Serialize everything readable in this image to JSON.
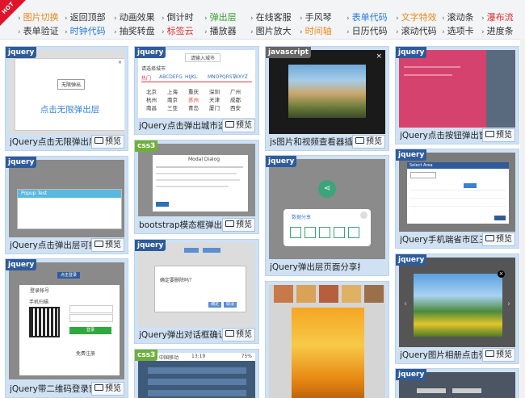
{
  "nav": {
    "hot_label": "HOT",
    "row1": [
      {
        "label": "图片切换",
        "color": "#e8891d"
      },
      {
        "label": "返回顶部",
        "color": "#333333"
      },
      {
        "label": "动画效果",
        "color": "#333333"
      },
      {
        "label": "倒计时",
        "color": "#333333"
      },
      {
        "label": "弹出层",
        "color": "#3aa02e"
      },
      {
        "label": "在线客服",
        "color": "#333333"
      },
      {
        "label": "手风琴",
        "color": "#333333"
      },
      {
        "label": "表单代码",
        "color": "#2a7bd6"
      },
      {
        "label": "文字特效",
        "color": "#e8891d"
      },
      {
        "label": "滚动条",
        "color": "#333333"
      },
      {
        "label": "瀑布流",
        "color": "#e03030"
      }
    ],
    "row2": [
      {
        "label": "表单验证",
        "color": "#333333"
      },
      {
        "label": "时钟代码",
        "color": "#2a7bd6"
      },
      {
        "label": "抽奖转盘",
        "color": "#333333"
      },
      {
        "label": "标签云",
        "color": "#e03030"
      },
      {
        "label": "播放器",
        "color": "#333333"
      },
      {
        "label": "图片放大",
        "color": "#333333"
      },
      {
        "label": "时间轴",
        "color": "#e8891d"
      },
      {
        "label": "日历代码",
        "color": "#333333"
      },
      {
        "label": "滚动代码",
        "color": "#333333"
      },
      {
        "label": "选项卡",
        "color": "#333333"
      },
      {
        "label": "进度条",
        "color": "#333333"
      }
    ]
  },
  "preview_label": "预览",
  "cards": {
    "c1": {
      "badge": "jquery",
      "title": "jQuery点击无限弹出层插件",
      "thumb_btn": "无限弹出",
      "thumb_link": "点击无限弹出层"
    },
    "c2": {
      "badge": "jquery",
      "title": "jQuery点击弹出城市选择器",
      "thumb_search": "请输入城市",
      "thumb_head": "请选择城市",
      "tabs": [
        "热门",
        "ABCDEFG",
        "HIJKL",
        "MNOPQRST",
        "WXYZ"
      ],
      "cities": [
        "北京",
        "上海",
        "重庆",
        "深圳",
        "广州",
        "杭州",
        "南京",
        "苏州",
        "天津",
        "成都",
        "南昌",
        "三亚",
        "青岛",
        "厦门",
        "西安"
      ]
    },
    "c3": {
      "badge": "javascript",
      "title": "js图片和视频查看器插件"
    },
    "c4": {
      "badge": "jquery",
      "title": "jQuery点击按钮弹出窗口动"
    },
    "c5": {
      "badge": "css3",
      "title": "bootstrap模态框弹出效果",
      "thumb_head": "Modal Dialog"
    },
    "c6": {
      "badge": "jquery",
      "title": "jQuery点击弹出层可拖动代",
      "thumb_head": "Popup Test"
    },
    "c7": {
      "badge": "jquery",
      "title": "jQuery弹出层页面分享插件",
      "thumb_head": "数据分享"
    },
    "c8": {
      "badge": "jquery",
      "title": "jQuery手机端省市区三级联",
      "thumb_head": "Select Area"
    },
    "c9": {
      "badge": "jquery",
      "title": "jQuery弹出对话框确认",
      "thumb_msg": "确定要删除吗？",
      "thumb_ok": "确定",
      "thumb_cancel": "取消"
    },
    "c10": {
      "badge": "jquery",
      "title": "jQuery带二维码登录窗口弹",
      "thumb_btn": "点击登录",
      "thumb_head": "登录帐号",
      "thumb_scan": "手机扫描",
      "thumb_login": "登录",
      "thumb_reg": "免费注册"
    },
    "c11": {
      "badge": "jquery",
      "title": "jQuery图片相册点击弹出大"
    },
    "c12": {
      "badge": "css3",
      "status_carrier": "中国移动",
      "status_time": "13:19",
      "status_batt": "75%"
    },
    "c13": {
      "badge": "jquery"
    }
  }
}
